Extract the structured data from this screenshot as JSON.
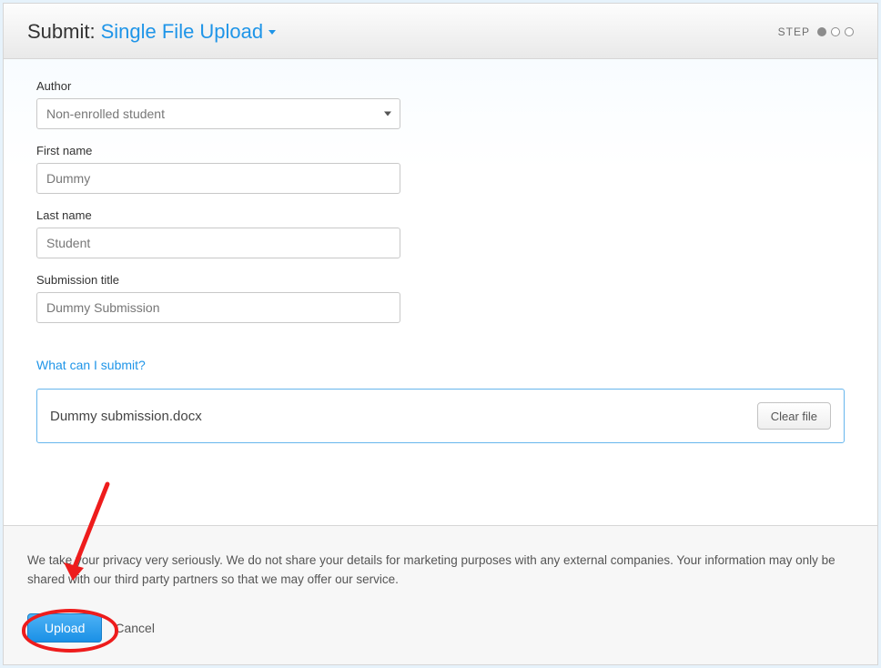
{
  "header": {
    "prefix": "Submit:",
    "mode": "Single File Upload",
    "step_label": "STEP"
  },
  "form": {
    "author": {
      "label": "Author",
      "value": "Non-enrolled student"
    },
    "first_name": {
      "label": "First name",
      "value": "Dummy"
    },
    "last_name": {
      "label": "Last name",
      "value": "Student"
    },
    "submission_title": {
      "label": "Submission title",
      "value": "Dummy Submission"
    }
  },
  "help_link": "What can I submit?",
  "file": {
    "name": "Dummy submission.docx",
    "clear_label": "Clear file"
  },
  "footer": {
    "privacy": "We take your privacy very seriously. We do not share your details for marketing purposes with any external companies. Your information may only be shared with our third party partners so that we may offer our service.",
    "upload_label": "Upload",
    "cancel_label": "Cancel"
  }
}
